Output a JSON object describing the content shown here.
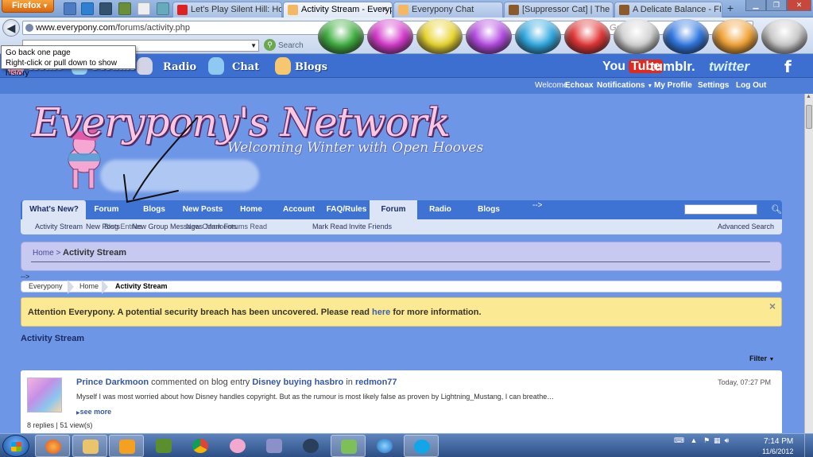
{
  "browser": {
    "menu_label": "Firefox",
    "tabs": [
      {
        "label": "Let's Play Silent Hill: Homec…",
        "active": false
      },
      {
        "label": "Activity Stream - Everyp…",
        "active": true
      },
      {
        "label": "Everypony Chat",
        "active": false
      },
      {
        "label": "[Suppressor Cat] | The Sc…",
        "active": false
      },
      {
        "label": "A Delicate Balance - FIM…",
        "active": false
      }
    ],
    "url": "www.everypony.com/forums/activity.php",
    "url_host": "www.everypony.com",
    "url_path": "/forums/activity.php",
    "search_engine_placeholder": "Google",
    "toolbar_search_label": "Search",
    "tooltip_line1": "Go back one page",
    "tooltip_line2": "Right-click or pull down to show history",
    "orb_colors": [
      "#3fae3f",
      "#d43acb",
      "#e8d531",
      "#b34ae0",
      "#2fa8e0",
      "#e23535",
      "#d3d3d3",
      "#2f77e0",
      "#f1a235",
      "#c9c9c9"
    ]
  },
  "site": {
    "top_links": [
      "Radio",
      "Chat",
      "Blogs"
    ],
    "partial_links": [
      "Home",
      "Forums"
    ],
    "social": {
      "youtube": "You",
      "youtube_tube": "Tube",
      "tumblr": "tumblr.",
      "twitter": "twitter",
      "facebook": "f"
    },
    "welcome": "Welcome,",
    "username": "Echoax",
    "user_menu": [
      "Notifications",
      "My Profile",
      "Settings",
      "Log Out"
    ],
    "logo_title": "Everypony's Network",
    "logo_sub": "Welcoming Winter with Open Hooves"
  },
  "nav": {
    "tabs": [
      "What's New?",
      "Forum",
      "Blogs",
      "New Posts",
      "Home",
      "Account",
      "FAQ/Rules",
      "Forum",
      "Radio",
      "Blogs"
    ],
    "selected_index": 7,
    "arrow": "-->",
    "sub_links": [
      "Activity Stream",
      "New Posts",
      "Blog Entries",
      "New Group Messages",
      "New Comments",
      "Mark Forums Read",
      "Mark Read",
      "Invite Friends"
    ],
    "advanced_search": "Advanced Search"
  },
  "breadcrumb_box": {
    "home": "Home >",
    "current": "Activity Stream"
  },
  "stray_arrow": "-->",
  "crumbbar": [
    "Everypony",
    "Home",
    "Activity Stream"
  ],
  "notice": {
    "text_before": "Attention Everypony. A potential security breach has been uncovered. Please read ",
    "link": "here",
    "text_after": " for more information.",
    "close": "×"
  },
  "activity_heading": "Activity Stream",
  "filter_label": "Filter",
  "entry": {
    "author": "Prince Darkmoon",
    "action": " commented on blog entry ",
    "entry_title": "Disney buying hasbro",
    "in_word": " in ",
    "blog_owner": "redmon77",
    "time": "Today, 07:27 PM",
    "excerpt": "Myself I was most worried about how Disney handles copyright. But as the rumour is most likely false as proven by Lightning_Mustang, I can breathe…",
    "see_more": "see more",
    "stats": "8 replies | 51 view(s)"
  },
  "taskbar": {
    "time": "7:14 PM",
    "date": "11/6/2012"
  }
}
